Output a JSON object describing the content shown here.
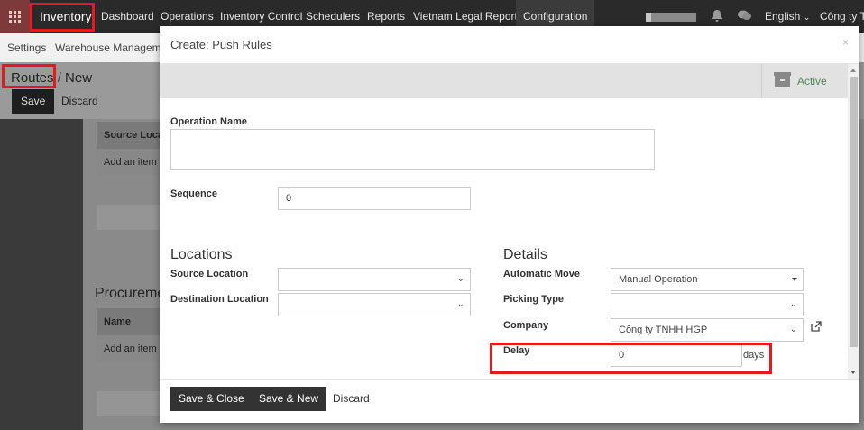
{
  "navbar": {
    "brand": "Inventory",
    "menu": [
      "Dashboard",
      "Operations",
      "Inventory Control",
      "Schedulers",
      "Reports",
      "Vietnam Legal Reports",
      "Configuration"
    ],
    "language": "English",
    "company": "Công ty TN"
  },
  "subnav": {
    "items": [
      "Settings",
      "Warehouse Management"
    ]
  },
  "background_page": {
    "breadcrumb_parent": "Routes",
    "breadcrumb_separator": "/",
    "breadcrumb_current": "New",
    "save_label": "Save",
    "discard_label": "Discard",
    "table1_header": "Source Loca",
    "table1_add": "Add an item",
    "section2_heading": "Procureme",
    "table2_header": "Name",
    "table2_add": "Add an item"
  },
  "modal": {
    "title": "Create: Push Rules",
    "close_glyph": "×",
    "active_label": "Active",
    "operation_name_label": "Operation Name",
    "operation_name_value": "",
    "sequence_label": "Sequence",
    "sequence_value": "0",
    "locations_title": "Locations",
    "source_location_label": "Source Location",
    "source_location_value": "",
    "destination_location_label": "Destination Location",
    "destination_location_value": "",
    "details_title": "Details",
    "automatic_move_label": "Automatic Move",
    "automatic_move_value": "Manual Operation",
    "picking_type_label": "Picking Type",
    "picking_type_value": "",
    "company_label": "Company",
    "company_value": "Công ty TNHH HGP",
    "delay_label": "Delay",
    "delay_value": "0",
    "delay_unit": "days",
    "save_close_label": "Save & Close",
    "save_new_label": "Save & New",
    "discard_label": "Discard"
  },
  "icons": {
    "apps": "apps-grid-icon",
    "bell": "bell-icon",
    "chat": "chat-icon",
    "archive": "archive-icon",
    "external": "external-link-icon",
    "dropdown": "chevron-down-icon"
  },
  "colors": {
    "navbar_bg": "#2a2a2a",
    "apps_bg": "#7c3a3a",
    "active_green": "#4f8a5b",
    "highlight_red": "#e8181e",
    "primary_button": "#333333"
  }
}
